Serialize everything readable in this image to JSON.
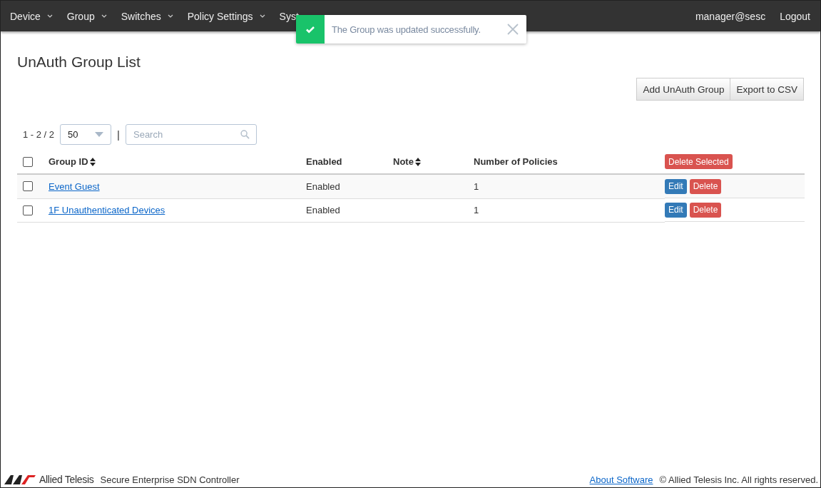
{
  "nav": {
    "items": [
      {
        "label": "Device",
        "caret": true
      },
      {
        "label": "Group",
        "caret": true
      },
      {
        "label": "Switches",
        "caret": true
      },
      {
        "label": "Policy Settings",
        "caret": true
      },
      {
        "label": "Syst",
        "caret": false
      }
    ],
    "user": "manager@sesc",
    "logout": "Logout"
  },
  "toast": {
    "message": "The Group was updated successfully."
  },
  "page": {
    "title": "UnAuth Group List",
    "buttons": [
      "Add UnAuth Group",
      "Export to CSV"
    ]
  },
  "toolbar": {
    "range": "1 - 2 / 2",
    "page_size": "50",
    "separator": "|",
    "search": {
      "placeholder": "Search"
    }
  },
  "table": {
    "select_all": {
      "checked": false
    },
    "columns": [
      {
        "label": "Group ID",
        "sortable": true
      },
      {
        "label": "Enabled",
        "sortable": false
      },
      {
        "label": "Note",
        "sortable": true
      },
      {
        "label": "Number of Policies",
        "sortable": false
      }
    ],
    "delete_selected": "Delete Selected",
    "rows": [
      {
        "checked": false,
        "group_id": "Event Guest",
        "enabled": "Enabled",
        "note": "",
        "policies": "1",
        "edit": "Edit",
        "delete": "Delete"
      },
      {
        "checked": false,
        "group_id": "1F Unauthenticated Devices",
        "enabled": "Enabled",
        "note": "",
        "policies": "1",
        "edit": "Edit",
        "delete": "Delete"
      }
    ]
  },
  "footer": {
    "brand": "Allied Telesis",
    "product": "Secure Enterprise SDN Controller",
    "link": "About Software",
    "copyright": "© Allied Telesis Inc. All rights reserved."
  }
}
